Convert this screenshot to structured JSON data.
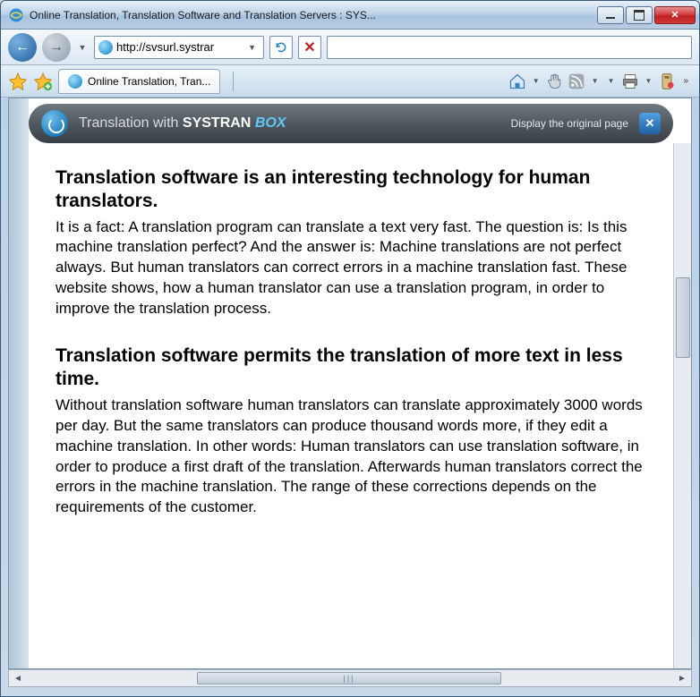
{
  "window": {
    "title": "Online Translation, Translation Software and Translation Servers : SYS..."
  },
  "nav": {
    "url": "http://svsurl.systrar"
  },
  "tab": {
    "title": "Online Translation, Tran..."
  },
  "systran": {
    "prefix": "Translation with ",
    "brand": "SYSTRAN",
    "box": "BOX",
    "link": "Display the original page"
  },
  "article": {
    "h1": "Translation software is an interesting technology for human translators.",
    "p1": "It is a fact: A translation program can translate a text very fast. The question is: Is this machine translation perfect? And the answer is: Machine translations are not perfect always. But human translators can correct errors in a machine translation fast. These website shows, how a human translator can use a translation program, in order to improve the translation process.",
    "h2": "Translation software permits the translation of more text in less time.",
    "p2": "Without translation software human translators can translate approximately 3000 words per day. But the same translators can produce thousand words more, if they edit a machine translation. In other words: Human translators can use translation software, in order to produce a first draft of the translation. Afterwards human translators correct the errors in the machine translation. The range of these corrections depends on the requirements of the customer."
  }
}
